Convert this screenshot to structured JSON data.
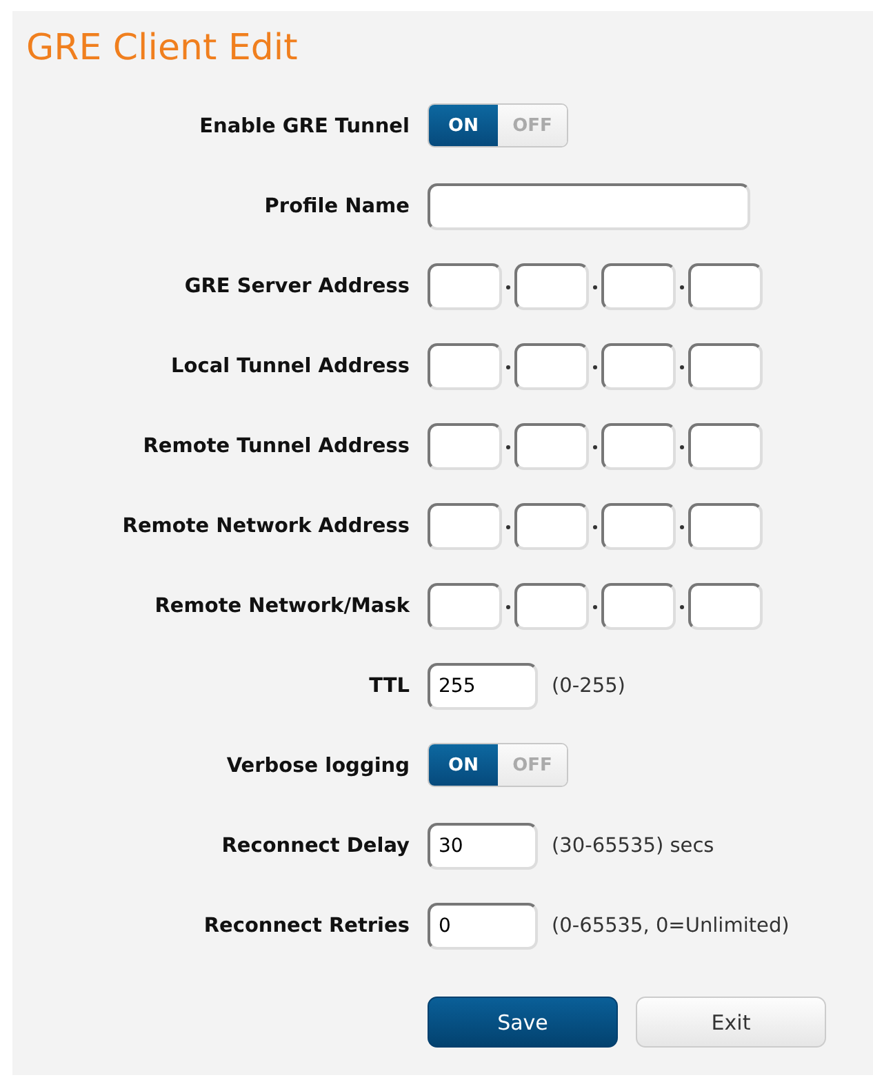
{
  "title": "GRE Client Edit",
  "fields": [
    {
      "kind": "toggle",
      "label": "Enable GRE Tunnel",
      "on": true,
      "on_label": "ON",
      "off_label": "OFF"
    },
    {
      "kind": "text",
      "label": "Profile Name"
    },
    {
      "kind": "ip",
      "label": "GRE Server Address"
    },
    {
      "kind": "ip",
      "label": "Local Tunnel Address"
    },
    {
      "kind": "ip",
      "label": "Remote Tunnel Address"
    },
    {
      "kind": "ip",
      "label": "Remote Network Address"
    },
    {
      "kind": "ip",
      "label": "Remote Network/Mask"
    },
    {
      "kind": "number",
      "label": "TTL",
      "value": "255",
      "hint": "(0-255)"
    },
    {
      "kind": "toggle",
      "label": "Verbose logging",
      "on": true,
      "on_label": "ON",
      "off_label": "OFF"
    },
    {
      "kind": "number",
      "label": "Reconnect Delay",
      "value": "30",
      "hint": "(30-65535) secs"
    },
    {
      "kind": "number",
      "label": "Reconnect Retries",
      "value": "0",
      "hint": "(0-65535, 0=Unlimited)"
    }
  ],
  "buttons": [
    {
      "kind": "primary",
      "label": "Save"
    },
    {
      "kind": "secondary",
      "label": "Exit"
    }
  ]
}
